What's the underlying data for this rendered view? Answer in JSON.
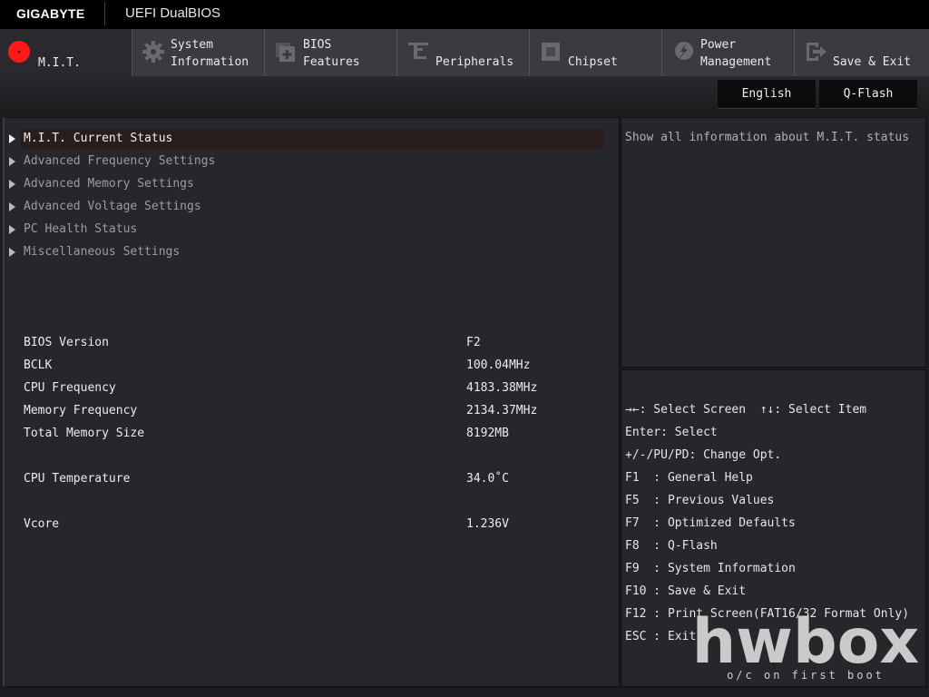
{
  "header": {
    "brand": "GIGABYTE",
    "title": "UEFI DualBIOS"
  },
  "tabs": [
    {
      "label": "M.I.T.",
      "icon": "mit-dial-icon",
      "active": true
    },
    {
      "label": "System\nInformation",
      "icon": "gear-icon"
    },
    {
      "label": "BIOS\nFeatures",
      "icon": "bios-chip-icon"
    },
    {
      "label": "Peripherals",
      "icon": "peripherals-icon"
    },
    {
      "label": "Chipset",
      "icon": "chipset-icon"
    },
    {
      "label": "Power\nManagement",
      "icon": "power-icon"
    },
    {
      "label": "Save & Exit",
      "icon": "exit-icon"
    }
  ],
  "toolbar": {
    "language": "English",
    "qflash": "Q-Flash"
  },
  "menu": [
    {
      "label": "M.I.T. Current Status",
      "selected": true
    },
    {
      "label": "Advanced Frequency Settings"
    },
    {
      "label": "Advanced Memory Settings"
    },
    {
      "label": "Advanced Voltage Settings"
    },
    {
      "label": "PC Health Status"
    },
    {
      "label": "Miscellaneous Settings"
    }
  ],
  "info": [
    {
      "label": "BIOS Version",
      "value": "F2"
    },
    {
      "label": "BCLK",
      "value": "100.04MHz"
    },
    {
      "label": "CPU Frequency",
      "value": "4183.38MHz"
    },
    {
      "label": "Memory Frequency",
      "value": "2134.37MHz"
    },
    {
      "label": "Total Memory Size",
      "value": "8192MB"
    },
    {
      "label": "CPU Temperature",
      "value": "34.0˚C"
    },
    {
      "label": "Vcore",
      "value": "1.236V"
    }
  ],
  "help": {
    "text": "Show all information about M.I.T. status"
  },
  "keys": [
    "→←: Select Screen  ↑↓: Select Item",
    "Enter: Select",
    "+/-/PU/PD: Change Opt.",
    "F1  : General Help",
    "F5  : Previous Values",
    "F7  : Optimized Defaults",
    "F8  : Q-Flash",
    "F9  : System Information",
    "F10 : Save & Exit",
    "F12 : Print Screen(FAT16/32 Format Only)",
    "ESC : Exit"
  ],
  "watermark": {
    "text": "hwbox",
    "tagline": "o/c on first boot"
  }
}
